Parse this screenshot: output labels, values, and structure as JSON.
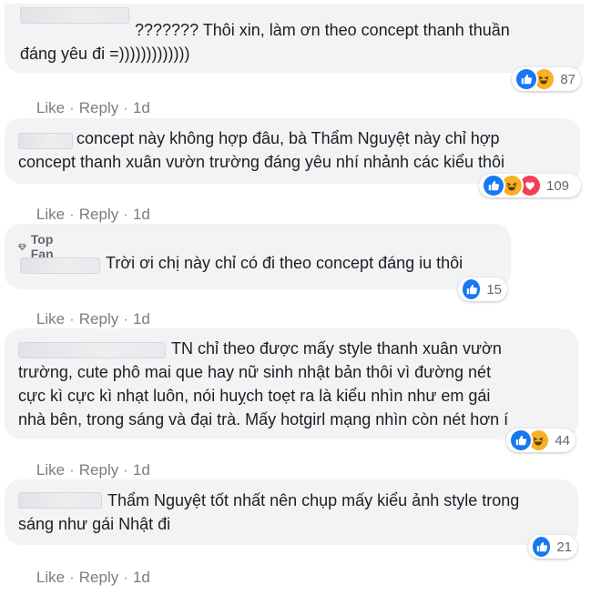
{
  "icons": [
    "like-icon",
    "haha-icon",
    "love-icon",
    "diamond-icon"
  ],
  "colors": {
    "bubble": "#f2f3f5",
    "like": "#1877f2",
    "haha": "#f7b125",
    "love": "#f33e58",
    "meta": "#65676b"
  },
  "actions": {
    "like": "Like",
    "reply": "Reply",
    "sep": "·",
    "time": "1d"
  },
  "badge": {
    "label": "Top Fan"
  },
  "comments": [
    {
      "lines": [
        "??????? Thôi xin, làm ơn theo concept thanh thuần",
        "đáng yêu đi =)))))))))))))"
      ],
      "reactions": [
        "like",
        "haha"
      ],
      "count": "87"
    },
    {
      "lines": [
        "concept này không hợp đâu, bà Thẩm Nguyệt này chỉ hợp",
        "concept thanh xuân vườn trường đáng yêu nhí nhảnh các kiểu thôi"
      ],
      "reactions": [
        "like",
        "haha",
        "love"
      ],
      "count": "109"
    },
    {
      "lines": [
        "Trời ơi chị này chỉ có đi theo concept đáng iu thôi"
      ],
      "reactions": [
        "like"
      ],
      "count": "15"
    },
    {
      "lines": [
        "TN chỉ theo được mấy style thanh xuân vườn",
        "trường, cute phô mai que hay nữ sinh nhật bản thôi vì đường nét",
        "cực kì cực kì nhạt luôn, nói huỵch toẹt ra là kiểu nhìn như em gái",
        "nhà bên, trong sáng và đại trà. Mấy hotgirl mạng nhìn còn nét hơn í"
      ],
      "reactions": [
        "like",
        "haha"
      ],
      "count": "44"
    },
    {
      "lines": [
        "Thẩm Nguyệt tốt nhất nên chụp mấy kiểu ảnh style trong",
        "sáng như gái Nhật đi"
      ],
      "reactions": [
        "like"
      ],
      "count": "21"
    }
  ]
}
